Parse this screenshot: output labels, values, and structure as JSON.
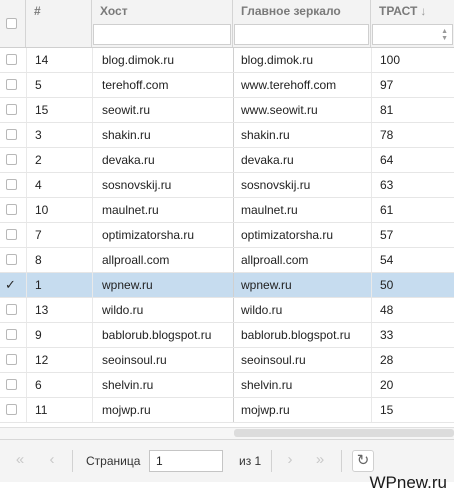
{
  "header": {
    "num_label": "#",
    "host_label": "Хост",
    "mirror_label": "Главное зеркало",
    "trust_label": "ТРАСТ",
    "trust_sort_icon": "↓"
  },
  "rows": [
    {
      "num": "14",
      "host": "blog.dimok.ru",
      "mirror": "blog.dimok.ru",
      "trust": "100",
      "checked": false
    },
    {
      "num": "5",
      "host": "terehoff.com",
      "mirror": "www.terehoff.com",
      "trust": "97",
      "checked": false
    },
    {
      "num": "15",
      "host": "seowit.ru",
      "mirror": "www.seowit.ru",
      "trust": "81",
      "checked": false
    },
    {
      "num": "3",
      "host": "shakin.ru",
      "mirror": "shakin.ru",
      "trust": "78",
      "checked": false
    },
    {
      "num": "2",
      "host": "devaka.ru",
      "mirror": "devaka.ru",
      "trust": "64",
      "checked": false
    },
    {
      "num": "4",
      "host": "sosnovskij.ru",
      "mirror": "sosnovskij.ru",
      "trust": "63",
      "checked": false
    },
    {
      "num": "10",
      "host": "maulnet.ru",
      "mirror": "maulnet.ru",
      "trust": "61",
      "checked": false
    },
    {
      "num": "7",
      "host": "optimizatorsha.ru",
      "mirror": "optimizatorsha.ru",
      "trust": "57",
      "checked": false
    },
    {
      "num": "8",
      "host": "allproall.com",
      "mirror": "allproall.com",
      "trust": "54",
      "checked": false
    },
    {
      "num": "1",
      "host": "wpnew.ru",
      "mirror": "wpnew.ru",
      "trust": "50",
      "checked": true
    },
    {
      "num": "13",
      "host": "wildo.ru",
      "mirror": "wildo.ru",
      "trust": "48",
      "checked": false
    },
    {
      "num": "9",
      "host": "bablorub.blogspot.ru",
      "mirror": "bablorub.blogspot.ru",
      "trust": "33",
      "checked": false
    },
    {
      "num": "12",
      "host": "seoinsoul.ru",
      "mirror": "seoinsoul.ru",
      "trust": "28",
      "checked": false
    },
    {
      "num": "6",
      "host": "shelvin.ru",
      "mirror": "shelvin.ru",
      "trust": "20",
      "checked": false
    },
    {
      "num": "11",
      "host": "mojwp.ru",
      "mirror": "mojwp.ru",
      "trust": "15",
      "checked": false
    }
  ],
  "pager": {
    "first_icon": "«",
    "prev_icon": "‹",
    "page_label": "Страница",
    "page_value": "1",
    "of_label": "из 1",
    "next_icon": "›",
    "last_icon": "»",
    "refresh_icon": "↻"
  },
  "watermark": "WPnew.ru",
  "colors": {
    "selected_row": "#c6dcef",
    "header_bg": "#f3f3f3",
    "pager_bg": "#f4f4f4"
  }
}
